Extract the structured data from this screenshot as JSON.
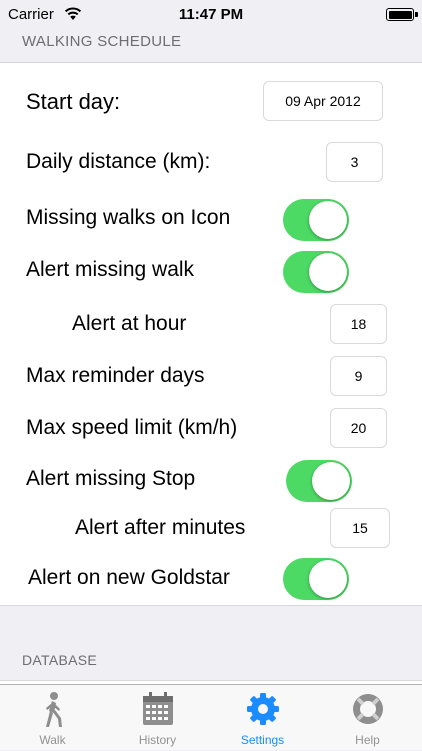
{
  "status_bar": {
    "carrier": "Carrier",
    "time": "11:47 PM",
    "battery_level": 1.0
  },
  "sections": {
    "walking_schedule": "WALKING SCHEDULE",
    "database": "DATABASE"
  },
  "settings": {
    "start_day": {
      "label": "Start day:",
      "value": "09 Apr 2012"
    },
    "daily_distance": {
      "label": "Daily distance (km):",
      "value": "3"
    },
    "missing_walks_icon": {
      "label": "Missing walks on Icon",
      "on": true
    },
    "alert_missing_walk": {
      "label": "Alert missing walk",
      "on": true
    },
    "alert_at_hour": {
      "label": "Alert at hour",
      "value": "18"
    },
    "max_reminder_days": {
      "label": "Max reminder days",
      "value": "9"
    },
    "max_speed_limit": {
      "label": "Max speed limit (km/h)",
      "value": "20"
    },
    "alert_missing_stop": {
      "label": "Alert missing Stop",
      "on": true
    },
    "alert_after_minutes": {
      "label": "Alert after minutes",
      "value": "15"
    },
    "alert_new_goldstar": {
      "label": "Alert on new Goldstar",
      "on": true
    }
  },
  "colors": {
    "switch_on": "#4cd964",
    "tab_active": "#1a8cff",
    "tab_inactive": "#929292"
  },
  "tabs": [
    {
      "label": "Walk",
      "icon": "walking-person-icon",
      "active": false
    },
    {
      "label": "History",
      "icon": "calendar-icon",
      "active": false
    },
    {
      "label": "Settings",
      "icon": "gear-icon",
      "active": true
    },
    {
      "label": "Help",
      "icon": "lifebuoy-icon",
      "active": false
    }
  ]
}
